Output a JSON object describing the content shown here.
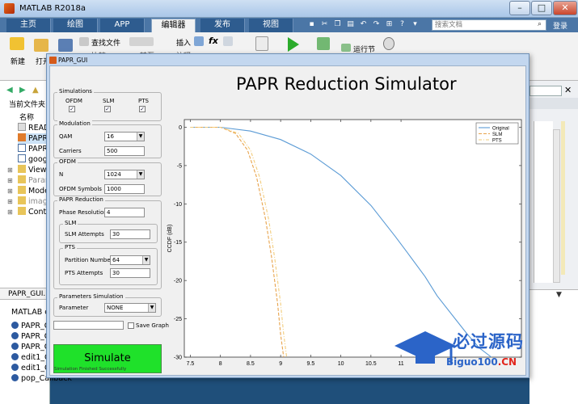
{
  "window": {
    "title": "MATLAB R2018a",
    "min": "–",
    "max": "□",
    "close": "✕"
  },
  "ribbon": {
    "tabs": [
      {
        "label": "主页",
        "active": false
      },
      {
        "label": "绘图",
        "active": false
      },
      {
        "label": "APP",
        "active": false
      },
      {
        "label": "编辑器",
        "active": true
      },
      {
        "label": "发布",
        "active": false
      },
      {
        "label": "视图",
        "active": false
      }
    ],
    "search_placeholder": "搜索文档",
    "login": "登录"
  },
  "toolstrip": {
    "new": "新建",
    "open": "打开",
    "find_files": "查找文件",
    "compare": "比较",
    "goto": "转至",
    "insert": "插入",
    "fx": "fx",
    "comment": "注释",
    "run_section": "运行节"
  },
  "left_panel": {
    "current_folder": "当前文件夹",
    "name_column": "名称",
    "files": [
      {
        "name": "README",
        "type": "file"
      },
      {
        "name": "PAPR_GUI.fig",
        "type": "fig",
        "selected": true
      },
      {
        "name": "PAPR_GUI.m",
        "type": "m"
      },
      {
        "name": "google",
        "type": "m"
      },
      {
        "name": "Views",
        "type": "folder"
      },
      {
        "name": "Parameters",
        "type": "folder"
      },
      {
        "name": "Models",
        "type": "folder"
      },
      {
        "name": "images",
        "type": "folder"
      },
      {
        "name": "Controllers",
        "type": "folder"
      }
    ],
    "details_title": "PAPR_GUI.m",
    "code_label": "MATLAB code",
    "functions": [
      "PAPR_GUI",
      "PAPR_GUI_OpeningFcn",
      "PAPR_GUI_OutputFcn",
      "edit1_Callback",
      "edit1_CreateFcn",
      "pop_Callback"
    ]
  },
  "gui": {
    "title": "PAPR_GUI",
    "heading": "PAPR Reduction Simulator",
    "simulations": {
      "title": "Simulations",
      "ofdm_label": "OFDM",
      "ofdm_checked": true,
      "slm_label": "SLM",
      "slm_checked": true,
      "pts_label": "PTS",
      "pts_checked": true
    },
    "modulation": {
      "title": "Modulation",
      "qam_label": "QAM",
      "qam_value": "16",
      "carriers_label": "Carriers",
      "carriers_value": "500"
    },
    "ofdm": {
      "title": "OFDM",
      "n_label": "N",
      "n_value": "1024",
      "symbols_label": "OFDM Symbols",
      "symbols_value": "1000"
    },
    "papr": {
      "title": "PAPR Reduction",
      "phase_label": "Phase Resolution",
      "phase_value": "4",
      "slm_title": "SLM",
      "slm_attempts_label": "SLM Attempts",
      "slm_attempts_value": "30",
      "pts_title": "PTS",
      "partition_label": "Partition Number",
      "partition_value": "64",
      "pts_attempts_label": "PTS Attempts",
      "pts_attempts_value": "30"
    },
    "params": {
      "title": "Parameters Simulation",
      "parameter_label": "Parameter",
      "parameter_value": "NONE"
    },
    "save_graph_label": "Save Graph",
    "save_graph_checked": false,
    "save_path_value": "",
    "simulate_label": "Simulate",
    "status": "Simulation Finished Successfully"
  },
  "chart_data": {
    "type": "line",
    "ylabel": "CCDF (dB)",
    "xlim": [
      7.4,
      13.0
    ],
    "ylim": [
      -30,
      1
    ],
    "xticks": [
      7.5,
      8,
      8.5,
      9,
      9.5,
      10,
      10.5,
      11
    ],
    "yticks": [
      0,
      -5,
      -10,
      -15,
      -20,
      -25,
      -30
    ],
    "legend_position": "top-right",
    "series": [
      {
        "name": "Original",
        "color": "#5b9bd5",
        "style": "solid",
        "x": [
          7.5,
          8.0,
          8.5,
          9.0,
          9.5,
          10.0,
          10.5,
          10.9,
          11.1,
          11.4,
          11.6,
          11.9,
          12.1,
          12.3,
          12.5
        ],
        "y": [
          0,
          0,
          -0.5,
          -1.6,
          -3.5,
          -6.3,
          -10.2,
          -14.2,
          -16.3,
          -19.5,
          -22.0,
          -25.0,
          -27.0,
          -28.8,
          -30.0
        ]
      },
      {
        "name": "SLM",
        "color": "#e8a34c",
        "style": "dashed",
        "x": [
          7.5,
          8.0,
          8.25,
          8.45,
          8.6,
          8.75,
          8.85,
          8.95,
          9.0,
          9.05
        ],
        "y": [
          0,
          0,
          -0.8,
          -3.0,
          -6.5,
          -12.0,
          -17.0,
          -23.0,
          -27.0,
          -30.0
        ]
      },
      {
        "name": "PTS",
        "color": "#f2cc7a",
        "style": "dashdot",
        "x": [
          7.5,
          8.0,
          8.3,
          8.5,
          8.65,
          8.8,
          8.9,
          9.0,
          9.05,
          9.1
        ],
        "y": [
          0,
          0,
          -0.8,
          -3.0,
          -6.5,
          -12.0,
          -17.0,
          -23.0,
          -27.0,
          -30.0
        ]
      }
    ]
  },
  "watermark": {
    "line1": "必过源码",
    "line2a": "Biguo100",
    "line2b": ".CN"
  }
}
